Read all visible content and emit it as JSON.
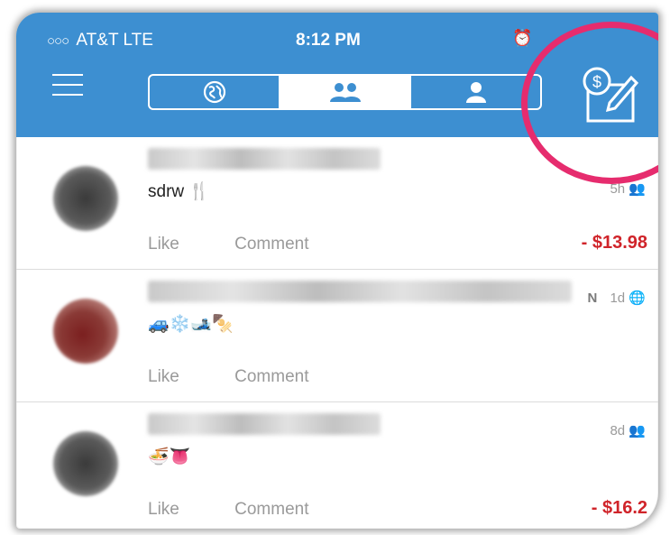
{
  "status_bar": {
    "carrier": "AT&T  LTE",
    "time": "8:12 PM"
  },
  "feed": {
    "items": [
      {
        "name": "Y",
        "description": "sdrw 🍴",
        "meta_time": "5h",
        "privacy_icon": "friends-icon",
        "like_label": "Like",
        "comment_label": "Comment",
        "amount": "- $13.98"
      },
      {
        "name": "M",
        "name_tail": "N",
        "description": "🚙❄️🎿🍢",
        "meta_time": "1d",
        "privacy_icon": "globe-icon",
        "like_label": "Like",
        "comment_label": "Comment",
        "amount": ""
      },
      {
        "name": "Y",
        "description": "🍜👅",
        "meta_time": "8d",
        "privacy_icon": "friends-icon",
        "like_label": "Like",
        "comment_label": "Comment",
        "amount": "- $16.2"
      }
    ]
  },
  "colors": {
    "header_blue": "#3d8fd1",
    "amount_red": "#d0242a",
    "highlight_pink": "#e62c6e"
  }
}
